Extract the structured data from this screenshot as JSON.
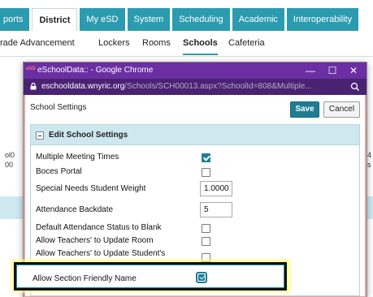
{
  "topnav": {
    "tabs": [
      {
        "label": "ports"
      },
      {
        "label": "District",
        "active": true
      },
      {
        "label": "My eSD"
      },
      {
        "label": "System"
      },
      {
        "label": "Scheduling"
      },
      {
        "label": "Academic"
      },
      {
        "label": "Interoperability"
      }
    ],
    "subnav": [
      {
        "label": "rade Advancement"
      },
      {
        "label": "Lockers"
      },
      {
        "label": "Rooms"
      },
      {
        "label": "Schools",
        "active": true
      },
      {
        "label": "Cafeteria"
      }
    ]
  },
  "background": {
    "left_text_1": "ol0",
    "left_text_2": "00",
    "right_text_1": "4",
    "right_text_2": "s"
  },
  "popup": {
    "logo_text": "eSD",
    "window_title": "eSchoolData:: - Google Chrome",
    "address_host": "eschooldata.wnyric.org",
    "address_path": "/Schools/SCH00013.aspx?SchoolId=808&Multiple...",
    "minimize_glyph": "—",
    "maximize_glyph": "☐",
    "close_glyph": "✕"
  },
  "settings": {
    "header": "School Settings",
    "save_label": "Save",
    "cancel_label": "Cancel",
    "panel_title": "Edit School Settings",
    "rows": [
      {
        "label": "Multiple Meeting Times",
        "type": "checkbox",
        "checked": true
      },
      {
        "label": "Boces Portal",
        "type": "checkbox",
        "checked": false
      },
      {
        "label": "Special Needs Student Weight",
        "type": "number",
        "value": "1.0000"
      },
      {
        "label": "Attendance Backdate",
        "type": "number",
        "value": "5"
      },
      {
        "label": "Default Attendance Status to Blank",
        "type": "checkbox",
        "checked": false
      },
      {
        "label": "Allow Teachers' to Update Room",
        "type": "checkbox",
        "checked": false
      },
      {
        "label": "Allow Teachers' to Update Student's",
        "type": "checkbox",
        "checked": false
      }
    ],
    "highlighted_row": {
      "label": "Allow Section Friendly Name",
      "checked": true
    }
  },
  "colors": {
    "tab_accent": "#2b9bb0",
    "chrome_title": "#6b2fa3",
    "chrome_address": "#4a2272",
    "primary_button": "#1f7d93",
    "highlight": "#ffff78"
  }
}
